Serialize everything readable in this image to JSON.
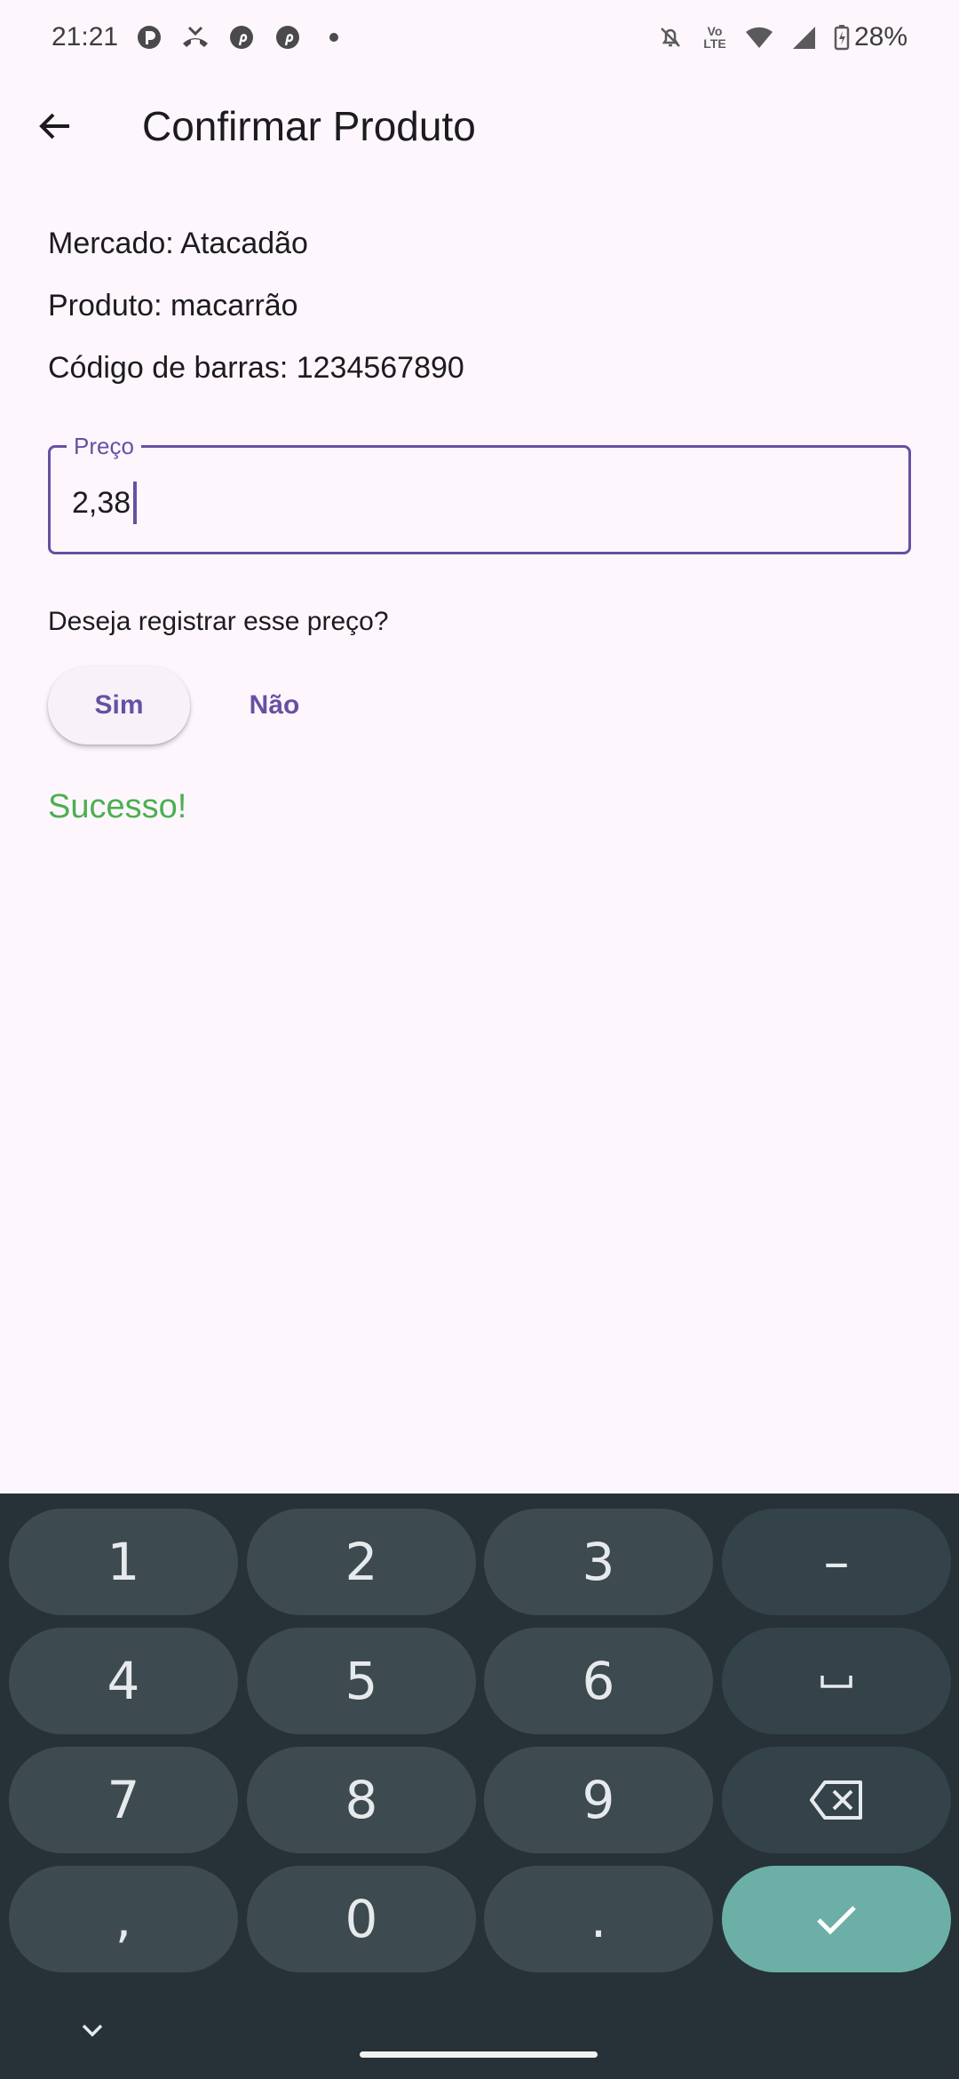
{
  "status_bar": {
    "time": "21:21",
    "battery": "28%",
    "network": "Vo LTE",
    "left_icons": [
      "app-icon",
      "missed-call-icon",
      "pinterest-icon",
      "pinterest-icon",
      "dot"
    ],
    "right_icons": [
      "silent-icon",
      "volte-icon",
      "wifi-icon",
      "signal-icon",
      "battery-charging-icon"
    ]
  },
  "app_bar": {
    "title": "Confirmar Produto",
    "back_icon": "arrow-back-icon"
  },
  "info": {
    "mercado": "Mercado: Atacadão",
    "produto": "Produto: macarrão",
    "codigo": "Código de barras: 1234567890"
  },
  "price_field": {
    "label": "Preço",
    "value": "2,38"
  },
  "confirm": {
    "question": "Deseja registrar esse preço?",
    "yes_label": "Sim",
    "no_label": "Não"
  },
  "success_message": "Sucesso!",
  "colors": {
    "background": "#fdf7fd",
    "primary": "#6750a4",
    "success": "#4caf50",
    "keyboard_bg": "#263238",
    "key_bg": "#3d4a50",
    "enter_key": "#6cafa6"
  },
  "keyboard": {
    "keys": [
      "1",
      "2",
      "3",
      "-",
      "4",
      "5",
      "6",
      "space",
      "7",
      "8",
      "9",
      "backspace",
      ",",
      "0",
      ".",
      "enter"
    ],
    "k1": "1",
    "k2": "2",
    "k3": "3",
    "kminus": "–",
    "k4": "4",
    "k5": "5",
    "k6": "6",
    "k7": "7",
    "k8": "8",
    "k9": "9",
    "kcomma": ",",
    "k0": "0",
    "kdot": "."
  }
}
